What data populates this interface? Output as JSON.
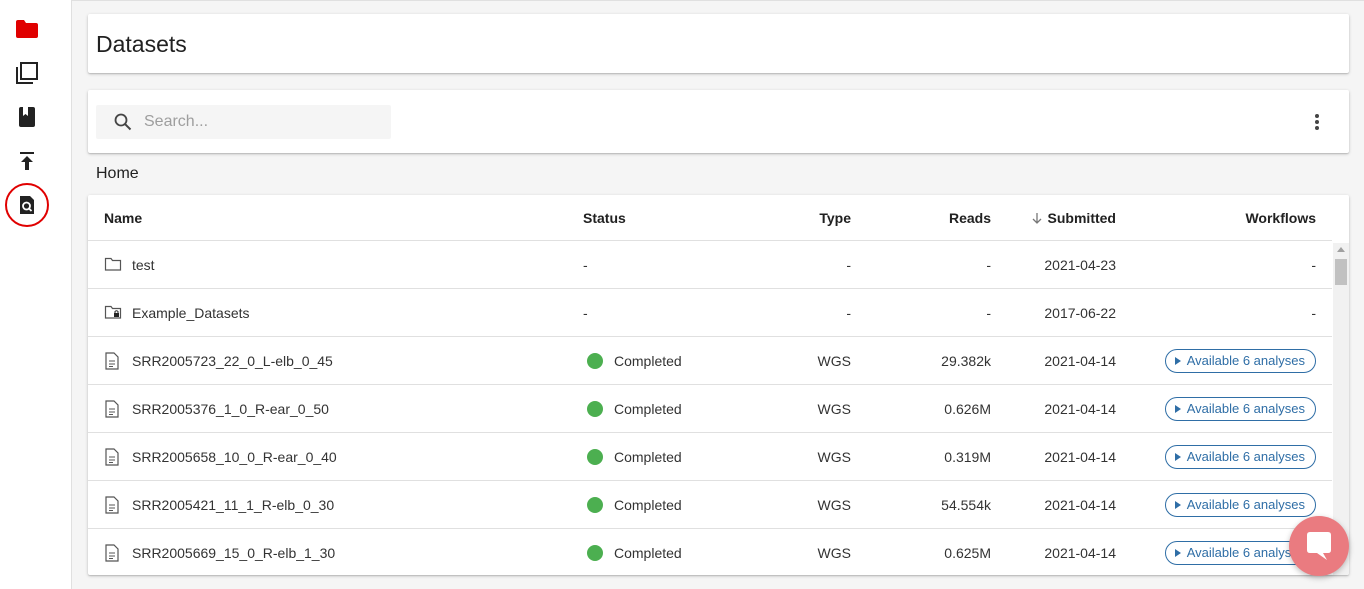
{
  "colors": {
    "accent_red": "#e00000",
    "status_green": "#4caf50",
    "link_blue": "#2f6ea6",
    "chat_pink": "#ea7b80"
  },
  "sidebar": {
    "items": [
      {
        "icon": "folder-icon",
        "active": true
      },
      {
        "icon": "collections-icon",
        "active": false
      },
      {
        "icon": "book-icon",
        "active": false
      },
      {
        "icon": "upload-icon",
        "active": false
      },
      {
        "icon": "search-document-icon",
        "active": false,
        "highlighted": true
      }
    ]
  },
  "header": {
    "title": "Datasets"
  },
  "search": {
    "placeholder": "Search...",
    "value": ""
  },
  "breadcrumb": {
    "label": "Home"
  },
  "table": {
    "columns": {
      "name": "Name",
      "status": "Status",
      "type": "Type",
      "reads": "Reads",
      "submitted": "Submitted",
      "workflows": "Workflows"
    },
    "sort": {
      "column": "submitted",
      "direction": "desc"
    },
    "rows": [
      {
        "icon": "folder-icon",
        "name": "test",
        "status": "-",
        "type": "-",
        "reads": "-",
        "submitted": "2021-04-23",
        "workflows": "-"
      },
      {
        "icon": "locked-folder-icon",
        "name": "Example_Datasets",
        "status": "-",
        "type": "-",
        "reads": "-",
        "submitted": "2017-06-22",
        "workflows": "-"
      },
      {
        "icon": "file-icon",
        "name": "SRR2005723_22_0_L-elb_0_45",
        "status": "Completed",
        "type": "WGS",
        "reads": "29.382k",
        "submitted": "2021-04-14",
        "workflows": "Available 6 analyses"
      },
      {
        "icon": "file-icon",
        "name": "SRR2005376_1_0_R-ear_0_50",
        "status": "Completed",
        "type": "WGS",
        "reads": "0.626M",
        "submitted": "2021-04-14",
        "workflows": "Available 6 analyses"
      },
      {
        "icon": "file-icon",
        "name": "SRR2005658_10_0_R-ear_0_40",
        "status": "Completed",
        "type": "WGS",
        "reads": "0.319M",
        "submitted": "2021-04-14",
        "workflows": "Available 6 analyses"
      },
      {
        "icon": "file-icon",
        "name": "SRR2005421_11_1_R-elb_0_30",
        "status": "Completed",
        "type": "WGS",
        "reads": "54.554k",
        "submitted": "2021-04-14",
        "workflows": "Available 6 analyses"
      },
      {
        "icon": "file-icon",
        "name": "SRR2005669_15_0_R-elb_1_30",
        "status": "Completed",
        "type": "WGS",
        "reads": "0.625M",
        "submitted": "2021-04-14",
        "workflows": "Available 6 analyses"
      }
    ]
  },
  "chat": {
    "icon": "chat-bubble-icon"
  }
}
